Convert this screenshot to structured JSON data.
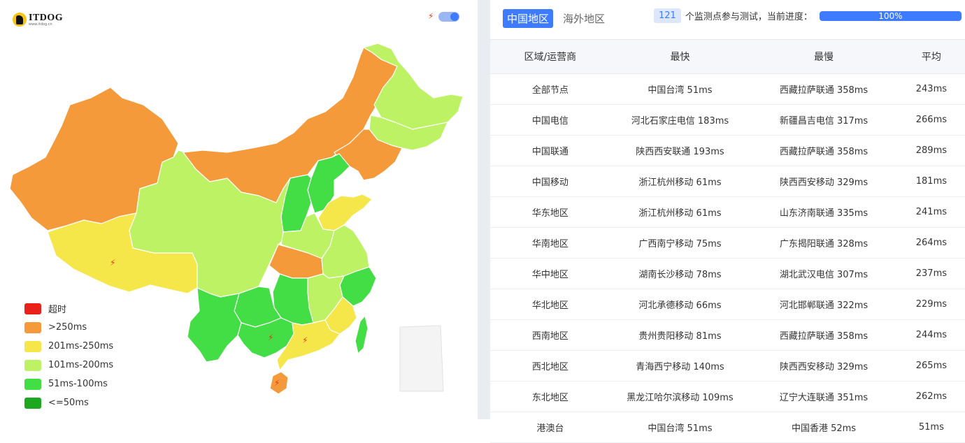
{
  "logo": {
    "name": "ITDOG",
    "sub": "www.itdog.cn"
  },
  "colors": {
    "timeout": "#e8221b",
    "gt250": "#f59a3a",
    "r201_250": "#f5e64a",
    "r101_200": "#bdf264",
    "r51_100": "#43dd45",
    "le50": "#1ea820",
    "accent": "#3e7bff"
  },
  "legend": [
    {
      "label": "超时",
      "color": "#e8221b"
    },
    {
      "label": ">250ms",
      "color": "#f59a3a"
    },
    {
      "label": "201ms-250ms",
      "color": "#f5e64a"
    },
    {
      "label": "101ms-200ms",
      "color": "#bdf264"
    },
    {
      "label": "51ms-100ms",
      "color": "#43dd45"
    },
    {
      "label": "<=50ms",
      "color": "#1ea820"
    }
  ],
  "tabs": [
    {
      "label": "中国地区",
      "active": true
    },
    {
      "label": "海外地区",
      "active": false
    }
  ],
  "progress": {
    "count": "121",
    "text": "个监测点参与测试，当前进度：",
    "percent_label": "100%",
    "value": 1.0
  },
  "table": {
    "headers": [
      "区域/运营商",
      "最快",
      "最慢",
      "平均"
    ],
    "rows": [
      [
        "全部节点",
        "中国台湾 51ms",
        "西藏拉萨联通 358ms",
        "243ms"
      ],
      [
        "中国电信",
        "河北石家庄电信 183ms",
        "新疆昌吉电信 317ms",
        "266ms"
      ],
      [
        "中国联通",
        "陕西西安联通 193ms",
        "西藏拉萨联通 358ms",
        "289ms"
      ],
      [
        "中国移动",
        "浙江杭州移动 61ms",
        "陕西西安移动 329ms",
        "181ms"
      ],
      [
        "华东地区",
        "浙江杭州移动 61ms",
        "山东济南联通 335ms",
        "241ms"
      ],
      [
        "华南地区",
        "广西南宁移动 75ms",
        "广东揭阳联通 328ms",
        "264ms"
      ],
      [
        "华中地区",
        "湖南长沙移动 78ms",
        "湖北武汉电信 307ms",
        "237ms"
      ],
      [
        "华北地区",
        "河北承德移动 66ms",
        "河北邯郸联通 322ms",
        "229ms"
      ],
      [
        "西南地区",
        "贵州贵阳移动 81ms",
        "西藏拉萨联通 358ms",
        "244ms"
      ],
      [
        "西北地区",
        "青海西宁移动 140ms",
        "陕西西安移动 329ms",
        "265ms"
      ],
      [
        "东北地区",
        "黑龙江哈尔滨移动 109ms",
        "辽宁大连联通 351ms",
        "262ms"
      ],
      [
        "港澳台",
        "中国台湾 51ms",
        "中国香港 52ms",
        "51ms"
      ]
    ]
  },
  "map": {
    "provinces": [
      {
        "name": "xinjiang",
        "color": "#f59a3a"
      },
      {
        "name": "xizang",
        "color": "#f5e64a"
      },
      {
        "name": "qinghai-gansu-sichuan",
        "color": "#bdf264"
      },
      {
        "name": "neimenggu",
        "color": "#f59a3a"
      },
      {
        "name": "heilongjiang",
        "color": "#bdf264"
      },
      {
        "name": "jilin",
        "color": "#bdf264"
      },
      {
        "name": "liaoning",
        "color": "#f59a3a"
      },
      {
        "name": "hebei",
        "color": "#43dd45"
      },
      {
        "name": "shanxi",
        "color": "#43dd45"
      },
      {
        "name": "shandong",
        "color": "#f5e64a"
      },
      {
        "name": "henan",
        "color": "#bdf264"
      },
      {
        "name": "hubei",
        "color": "#f59a3a"
      },
      {
        "name": "jiangsu-anhui",
        "color": "#bdf264"
      },
      {
        "name": "zhejiang",
        "color": "#43dd45"
      },
      {
        "name": "jiangxi",
        "color": "#bdf264"
      },
      {
        "name": "fujian",
        "color": "#f5e64a"
      },
      {
        "name": "hunan",
        "color": "#43dd45"
      },
      {
        "name": "guizhou",
        "color": "#43dd45"
      },
      {
        "name": "yunnan",
        "color": "#43dd45"
      },
      {
        "name": "guangxi",
        "color": "#43dd45"
      },
      {
        "name": "guangdong",
        "color": "#f5e64a"
      },
      {
        "name": "hainan",
        "color": "#f59a3a"
      },
      {
        "name": "taiwan",
        "color": "#43dd45"
      }
    ]
  }
}
